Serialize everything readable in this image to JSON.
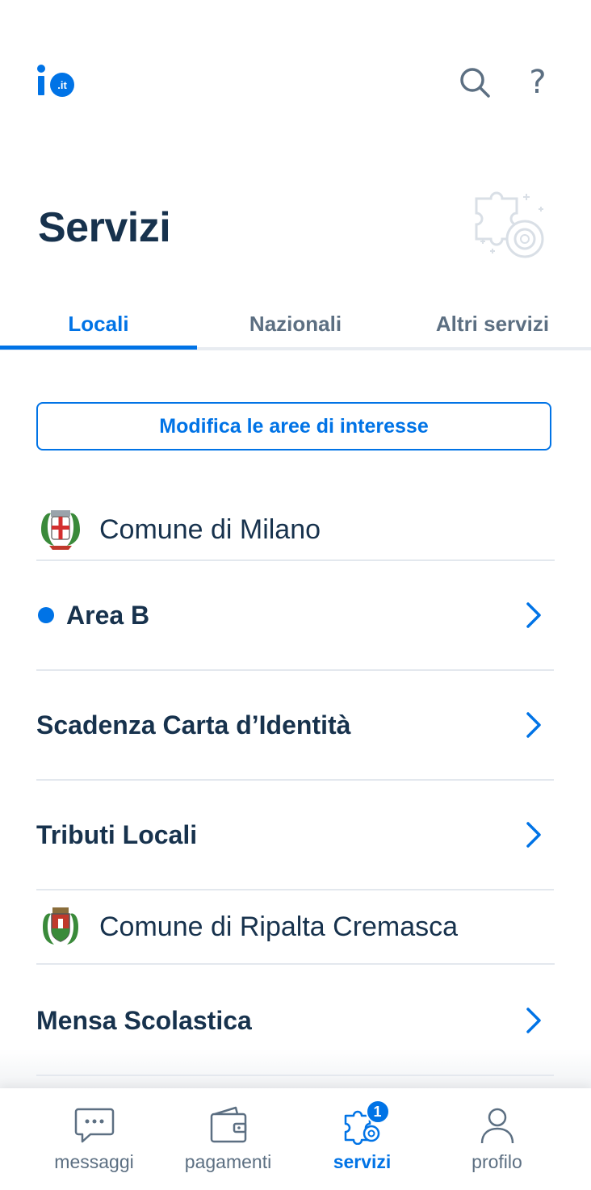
{
  "header": {
    "logo_text": ".it",
    "help_label": "?"
  },
  "page": {
    "title": "Servizi"
  },
  "tabs": [
    {
      "label": "Locali",
      "active": true
    },
    {
      "label": "Nazionali",
      "active": false
    },
    {
      "label": "Altri servizi",
      "active": false
    }
  ],
  "edit_button": {
    "label": "Modifica le aree di interesse"
  },
  "organizations": [
    {
      "name": "Comune di Milano",
      "services": [
        {
          "label": "Area B",
          "unread": true
        },
        {
          "label": "Scadenza Carta d’Identità",
          "unread": false
        },
        {
          "label": "Tributi Locali",
          "unread": false
        }
      ]
    },
    {
      "name": "Comune di Ripalta Cremasca",
      "services": [
        {
          "label": "Mensa Scolastica",
          "unread": false
        }
      ]
    }
  ],
  "bottom_nav": [
    {
      "label": "messaggi",
      "icon": "message-icon",
      "active": false
    },
    {
      "label": "pagamenti",
      "icon": "wallet-icon",
      "active": false
    },
    {
      "label": "servizi",
      "icon": "puzzle-icon",
      "active": true,
      "badge": "1"
    },
    {
      "label": "profilo",
      "icon": "user-icon",
      "active": false
    }
  ],
  "colors": {
    "accent": "#0073e6",
    "text_dark": "#17324d",
    "text_muted": "#5c6f82"
  }
}
